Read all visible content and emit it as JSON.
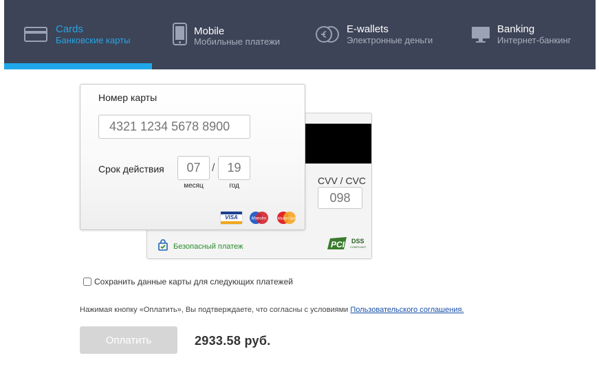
{
  "colors": {
    "tabs_background": "#3d4457",
    "active_tab_text": "#28a3e3",
    "active_underline": "#1fa7ea",
    "pay_button": "#d6d6d6",
    "secure_text": "#2a8c2a",
    "link": "#1a4fa8"
  },
  "tabs": [
    {
      "title": "Cards",
      "subtitle": "Банковские карты",
      "icon": "credit-card-icon",
      "active": true
    },
    {
      "title": "Mobile",
      "subtitle": "Мобильные платежи",
      "icon": "mobile-phone-icon",
      "active": false
    },
    {
      "title": "E-wallets",
      "subtitle": "Электронные деньги",
      "icon": "e-wallet-coins-icon",
      "active": false
    },
    {
      "title": "Banking",
      "subtitle": "Интернет-банкинг",
      "icon": "monitor-icon",
      "active": false
    }
  ],
  "card_form": {
    "card_number_label": "Номер карты",
    "card_number_placeholder": "4321 1234 5678 8900",
    "expiry_label": "Срок действия",
    "month_placeholder": "07",
    "year_placeholder": "19",
    "expiry_separator": "/",
    "month_hint": "месяц",
    "year_hint": "год",
    "cvv_label": "CVV / CVC",
    "cvv_placeholder": "098",
    "brand_logos": [
      {
        "name": "VISA",
        "icon": "visa-logo"
      },
      {
        "name": "Maestro",
        "icon": "maestro-logo"
      },
      {
        "name": "MasterCard",
        "icon": "mastercard-logo"
      }
    ],
    "secure_payment_text": "Безопасный платеж",
    "pci_logo": {
      "mark": "PCI",
      "text": "DSS",
      "small": "COMPLIANT"
    }
  },
  "save_card_label": "Сохранить данные карты для следующих платежей",
  "save_card_checked": false,
  "agreement": {
    "text": "Нажимая кнопку «Оплатить», Вы подтверждаете, что согласны с условиями",
    "link_text": "Пользовательского соглашения."
  },
  "pay_button_label": "Оплатить",
  "amount": "2933.58 руб."
}
